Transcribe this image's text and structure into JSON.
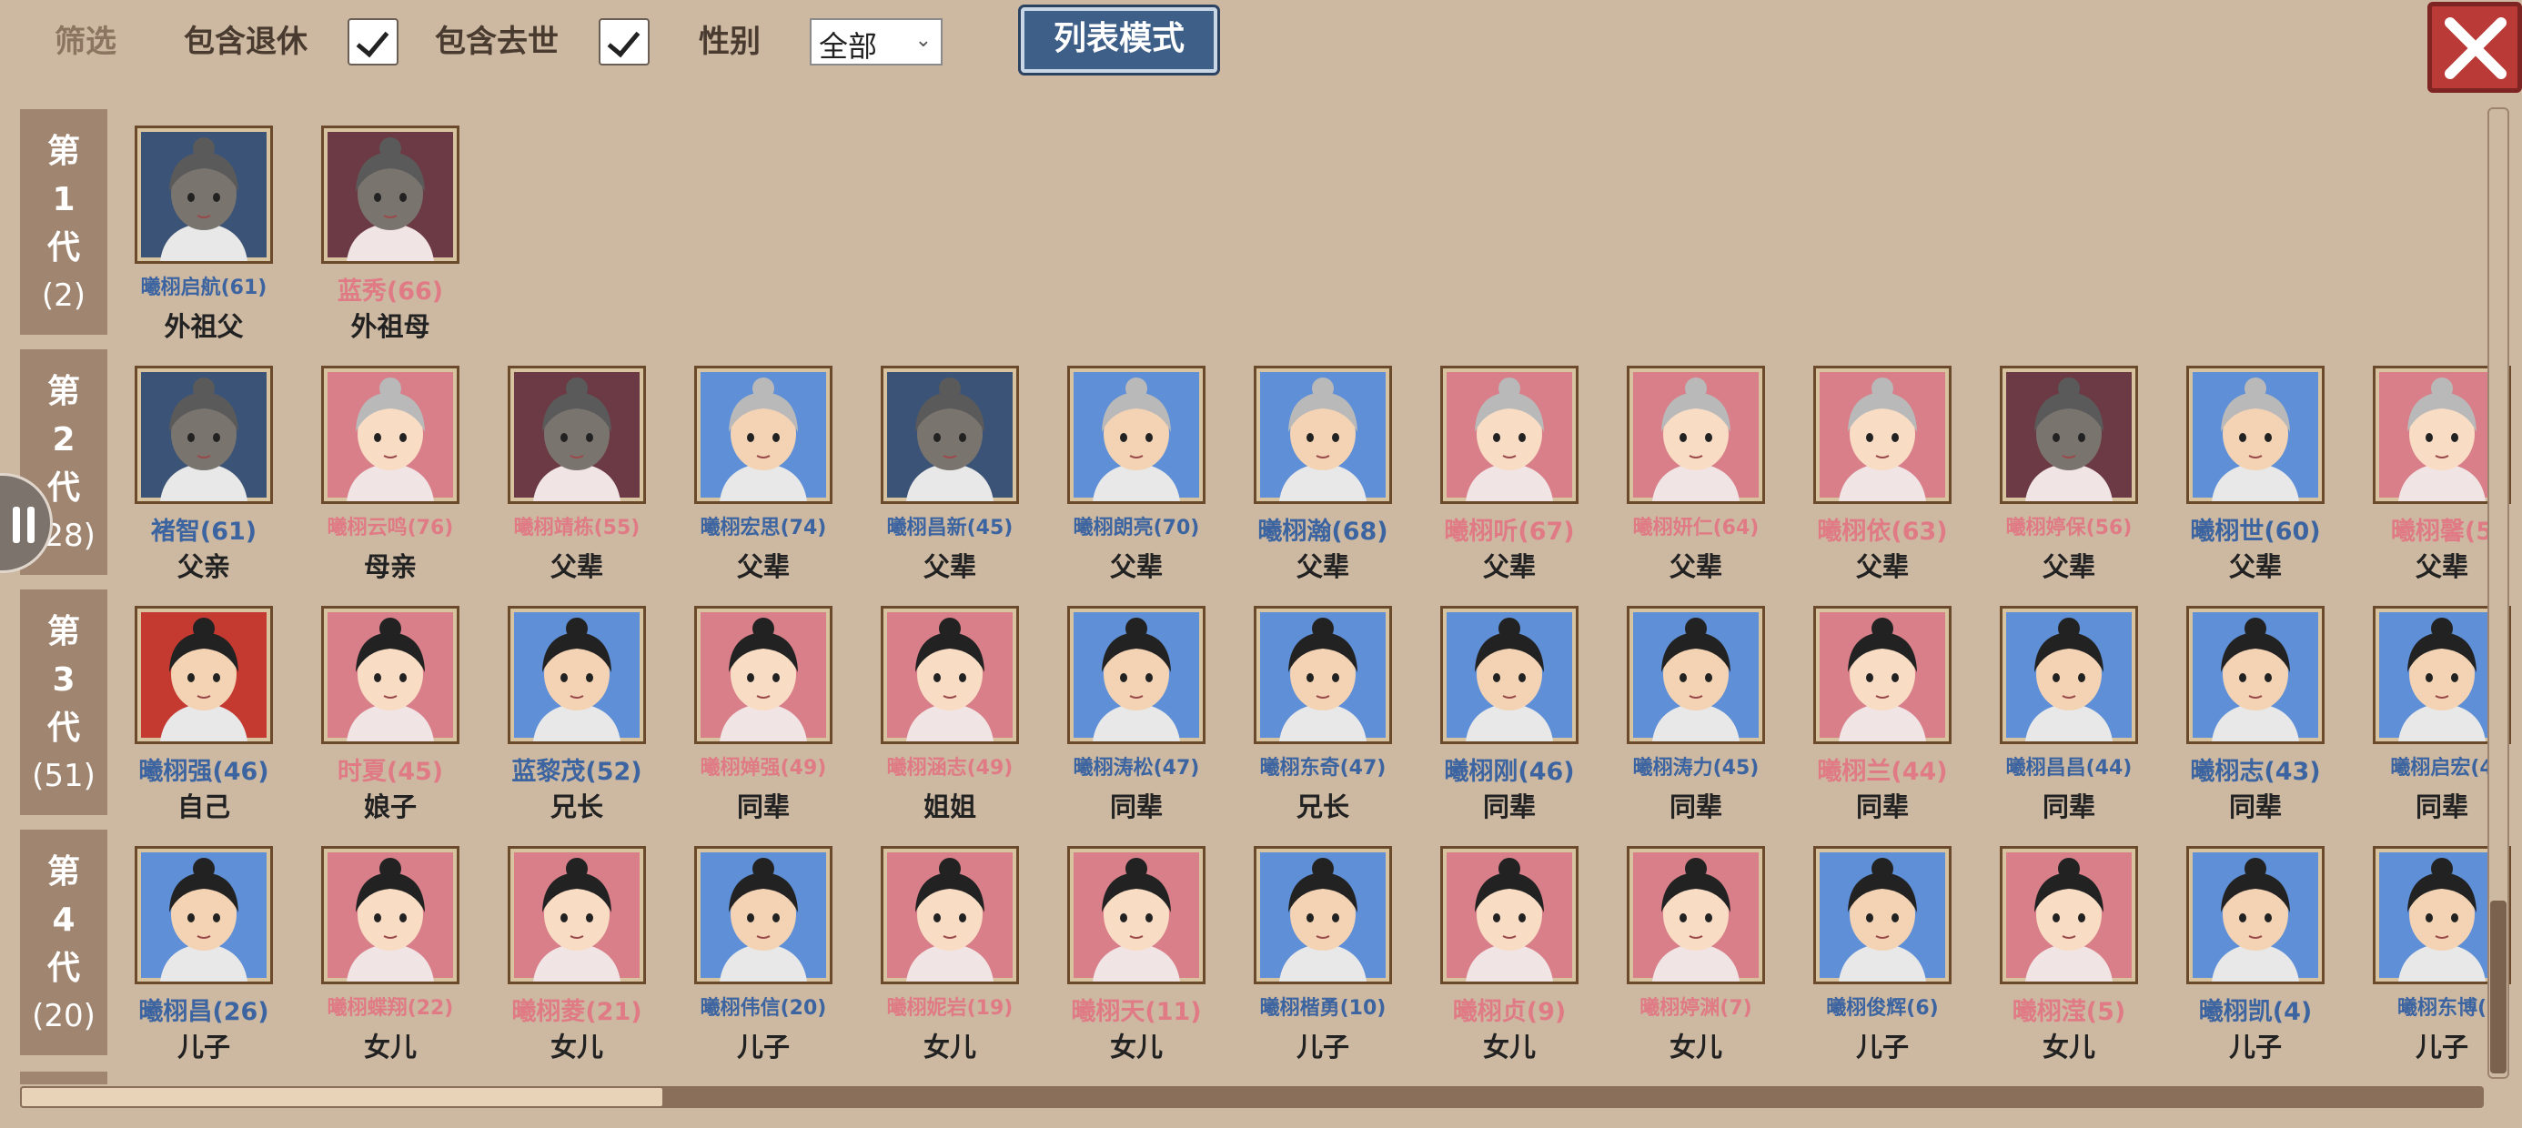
{
  "toolbar": {
    "filter_label": "筛选",
    "include_retired_label": "包含退休",
    "include_retired": true,
    "include_deceased_label": "包含去世",
    "include_deceased": true,
    "gender_label": "性别",
    "gender_value": "全部",
    "list_mode_label": "列表模式"
  },
  "icons": [
    "close-icon",
    "checkmark-icon",
    "chevron-down-icon",
    "pause-icon"
  ],
  "generations": [
    {
      "label": [
        "第",
        "1",
        "代"
      ],
      "count": "(2)",
      "members": [
        {
          "name": "曦栩启航(61)",
          "relation": "外祖父",
          "gender": "m",
          "bg": "navy",
          "small": true
        },
        {
          "name": "蓝秀(66)",
          "relation": "外祖母",
          "gender": "f",
          "bg": "maroon",
          "small": false
        }
      ]
    },
    {
      "label": [
        "第",
        "2",
        "代"
      ],
      "count": "(28)",
      "members": [
        {
          "name": "褚智(61)",
          "relation": "父亲",
          "gender": "m",
          "bg": "navy",
          "small": false
        },
        {
          "name": "曦栩云鸣(76)",
          "relation": "母亲",
          "gender": "f",
          "bg": "pink",
          "small": true
        },
        {
          "name": "曦栩靖栋(55)",
          "relation": "父辈",
          "gender": "f",
          "bg": "maroon",
          "small": true
        },
        {
          "name": "曦栩宏思(74)",
          "relation": "父辈",
          "gender": "m",
          "bg": "blue",
          "small": true
        },
        {
          "name": "曦栩昌新(45)",
          "relation": "父辈",
          "gender": "m",
          "bg": "navy",
          "small": true
        },
        {
          "name": "曦栩朗亮(70)",
          "relation": "父辈",
          "gender": "m",
          "bg": "blue",
          "small": true
        },
        {
          "name": "曦栩瀚(68)",
          "relation": "父辈",
          "gender": "m",
          "bg": "blue",
          "small": false
        },
        {
          "name": "曦栩听(67)",
          "relation": "父辈",
          "gender": "f",
          "bg": "pink",
          "small": false
        },
        {
          "name": "曦栩妍仁(64)",
          "relation": "父辈",
          "gender": "f",
          "bg": "pink",
          "small": true
        },
        {
          "name": "曦栩依(63)",
          "relation": "父辈",
          "gender": "f",
          "bg": "pink",
          "small": false
        },
        {
          "name": "曦栩婷保(56)",
          "relation": "父辈",
          "gender": "f",
          "bg": "maroon",
          "small": true
        },
        {
          "name": "曦栩世(60)",
          "relation": "父辈",
          "gender": "m",
          "bg": "blue",
          "small": false
        },
        {
          "name": "曦栩馨(5",
          "relation": "父辈",
          "gender": "f",
          "bg": "pink",
          "small": false
        }
      ]
    },
    {
      "label": [
        "第",
        "3",
        "代"
      ],
      "count": "(51)",
      "members": [
        {
          "name": "曦栩强(46)",
          "relation": "自己",
          "gender": "m",
          "bg": "red",
          "small": false
        },
        {
          "name": "时夏(45)",
          "relation": "娘子",
          "gender": "f",
          "bg": "pink",
          "small": false
        },
        {
          "name": "蓝黎茂(52)",
          "relation": "兄长",
          "gender": "m",
          "bg": "blue",
          "small": false
        },
        {
          "name": "曦栩婵强(49)",
          "relation": "同辈",
          "gender": "f",
          "bg": "pink",
          "small": true
        },
        {
          "name": "曦栩涵志(49)",
          "relation": "姐姐",
          "gender": "f",
          "bg": "pink",
          "small": true
        },
        {
          "name": "曦栩涛松(47)",
          "relation": "同辈",
          "gender": "m",
          "bg": "blue",
          "small": true
        },
        {
          "name": "曦栩东奇(47)",
          "relation": "兄长",
          "gender": "m",
          "bg": "blue",
          "small": true
        },
        {
          "name": "曦栩刚(46)",
          "relation": "同辈",
          "gender": "m",
          "bg": "blue",
          "small": false
        },
        {
          "name": "曦栩涛力(45)",
          "relation": "同辈",
          "gender": "m",
          "bg": "blue",
          "small": true
        },
        {
          "name": "曦栩兰(44)",
          "relation": "同辈",
          "gender": "f",
          "bg": "pink",
          "small": false
        },
        {
          "name": "曦栩昌昌(44)",
          "relation": "同辈",
          "gender": "m",
          "bg": "blue",
          "small": true
        },
        {
          "name": "曦栩志(43)",
          "relation": "同辈",
          "gender": "m",
          "bg": "blue",
          "small": false
        },
        {
          "name": "曦栩启宏(4",
          "relation": "同辈",
          "gender": "m",
          "bg": "blue",
          "small": true
        }
      ]
    },
    {
      "label": [
        "第",
        "4",
        "代"
      ],
      "count": "(20)",
      "members": [
        {
          "name": "曦栩昌(26)",
          "relation": "儿子",
          "gender": "m",
          "bg": "blue",
          "small": false
        },
        {
          "name": "曦栩蝶翔(22)",
          "relation": "女儿",
          "gender": "f",
          "bg": "pink",
          "small": true
        },
        {
          "name": "曦栩菱(21)",
          "relation": "女儿",
          "gender": "f",
          "bg": "pink",
          "small": false
        },
        {
          "name": "曦栩伟信(20)",
          "relation": "儿子",
          "gender": "m",
          "bg": "blue",
          "small": true
        },
        {
          "name": "曦栩妮岩(19)",
          "relation": "女儿",
          "gender": "f",
          "bg": "pink",
          "small": true
        },
        {
          "name": "曦栩天(11)",
          "relation": "女儿",
          "gender": "f",
          "bg": "pink",
          "small": false
        },
        {
          "name": "曦栩楷勇(10)",
          "relation": "儿子",
          "gender": "m",
          "bg": "blue",
          "small": true
        },
        {
          "name": "曦栩贞(9)",
          "relation": "女儿",
          "gender": "f",
          "bg": "pink",
          "small": false
        },
        {
          "name": "曦栩婷渊(7)",
          "relation": "女儿",
          "gender": "f",
          "bg": "pink",
          "small": true
        },
        {
          "name": "曦栩俊辉(6)",
          "relation": "儿子",
          "gender": "m",
          "bg": "blue",
          "small": true
        },
        {
          "name": "曦栩滢(5)",
          "relation": "女儿",
          "gender": "f",
          "bg": "pink",
          "small": false
        },
        {
          "name": "曦栩凯(4)",
          "relation": "儿子",
          "gender": "m",
          "bg": "blue",
          "small": false
        },
        {
          "name": "曦栩东博(",
          "relation": "儿子",
          "gender": "m",
          "bg": "blue",
          "small": true
        }
      ]
    }
  ],
  "colors": {
    "male_name": "#3c64a0",
    "female_name": "#e07b86",
    "panel_bg": "#cdb9a2",
    "gen_label_bg": "#a08670",
    "list_mode_button": "#3e5f87",
    "close_button": "#b93a37"
  }
}
